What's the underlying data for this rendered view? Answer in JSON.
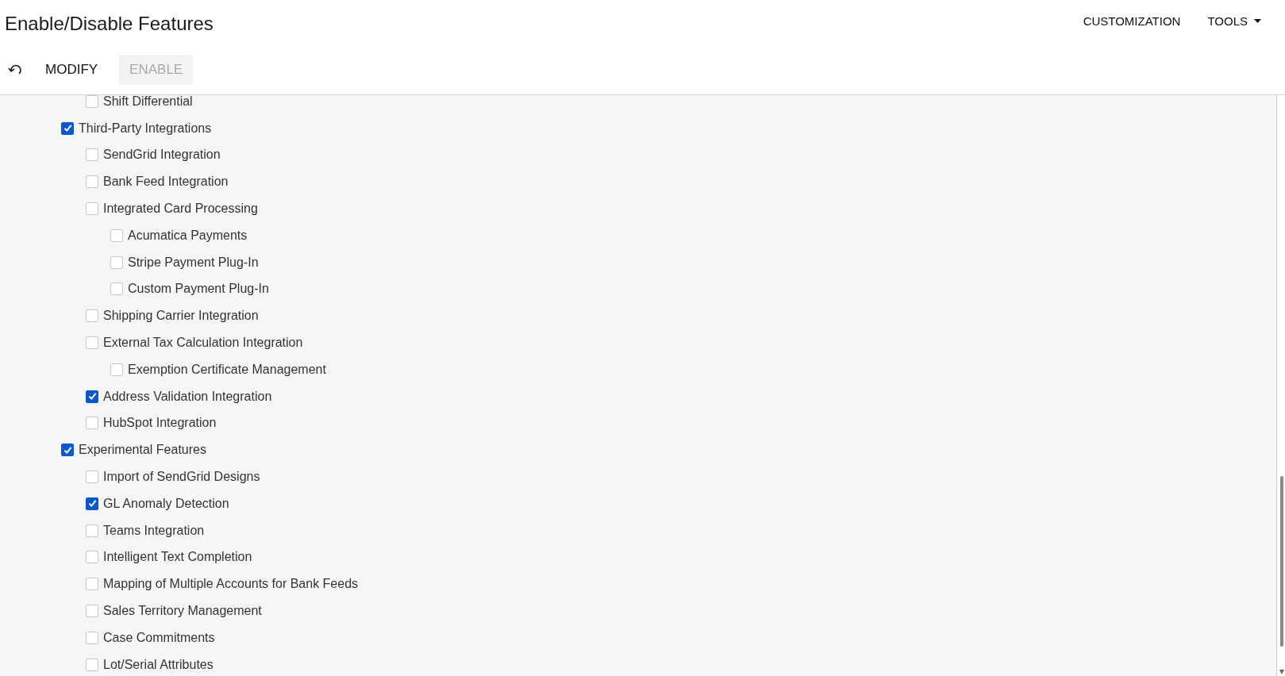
{
  "header": {
    "title": "Enable/Disable Features",
    "menus": [
      {
        "label": "CUSTOMIZATION",
        "dropdown": false
      },
      {
        "label": "TOOLS",
        "dropdown": true
      }
    ]
  },
  "toolbar": {
    "buttons": [
      {
        "label": "MODIFY",
        "disabled": false
      },
      {
        "label": "ENABLE",
        "disabled": true
      }
    ]
  },
  "features": [
    {
      "children": [
        {
          "label": "Shift Differential",
          "checked": false
        }
      ]
    },
    {
      "label": "Third-Party Integrations",
      "checked": true,
      "children": [
        {
          "label": "SendGrid Integration",
          "checked": false
        },
        {
          "label": "Bank Feed Integration",
          "checked": false
        },
        {
          "label": "Integrated Card Processing",
          "checked": false,
          "children": [
            {
              "label": "Acumatica Payments",
              "checked": false
            },
            {
              "label": "Stripe Payment Plug-In",
              "checked": false
            },
            {
              "label": "Custom Payment Plug-In",
              "checked": false
            }
          ]
        },
        {
          "label": "Shipping Carrier Integration",
          "checked": false
        },
        {
          "label": "External Tax Calculation Integration",
          "checked": false,
          "children": [
            {
              "label": "Exemption Certificate Management",
              "checked": false
            }
          ]
        },
        {
          "label": "Address Validation Integration",
          "checked": true
        },
        {
          "label": "HubSpot Integration",
          "checked": false
        }
      ]
    },
    {
      "label": "Experimental Features",
      "checked": true,
      "children": [
        {
          "label": "Import of SendGrid Designs",
          "checked": false
        },
        {
          "label": "GL Anomaly Detection",
          "checked": true
        },
        {
          "label": "Teams Integration",
          "checked": false
        },
        {
          "label": "Intelligent Text Completion",
          "checked": false
        },
        {
          "label": "Mapping of Multiple Accounts for Bank Feeds",
          "checked": false
        },
        {
          "label": "Sales Territory Management",
          "checked": false
        },
        {
          "label": "Case Commitments",
          "checked": false
        },
        {
          "label": "Lot/Serial Attributes",
          "checked": false
        }
      ]
    }
  ]
}
